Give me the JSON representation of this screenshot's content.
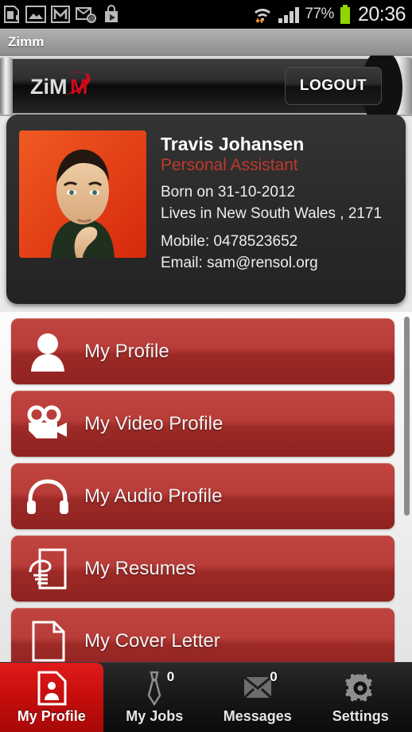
{
  "statusbar": {
    "icons": [
      "sdcard-icon",
      "gallery-icon",
      "gmail-icon",
      "email-icon",
      "play-store-icon"
    ],
    "wifi_icon": "wifi-icon",
    "signal_icon": "signal-bars-icon",
    "battery_percent": "77%",
    "battery_icon": "battery-icon",
    "clock": "20:36"
  },
  "titlebar": {
    "title": "Zimm"
  },
  "header": {
    "logo_text_light": "ZiM",
    "logo_text_red": "M",
    "logo_name": "zimm-logo",
    "logout_label": "LOGOUT"
  },
  "profile": {
    "avatar_name": "profile-photo",
    "name": "Travis Johansen",
    "role": "Personal Assistant",
    "born": "Born on 31-10-2012",
    "lives": "Lives in New South Wales , 2171",
    "mobile": "Mobile: 0478523652",
    "email": "Email: sam@rensol.org"
  },
  "menu": {
    "items": [
      {
        "label": "My Profile",
        "icon": "person-icon"
      },
      {
        "label": "My Video Profile",
        "icon": "video-camera-icon"
      },
      {
        "label": "My Audio Profile",
        "icon": "headphones-icon"
      },
      {
        "label": "My Resumes",
        "icon": "resume-hand-icon"
      },
      {
        "label": "My Cover Letter",
        "icon": "document-icon"
      }
    ]
  },
  "tabs": [
    {
      "label": "My Profile",
      "icon": "profile-card-icon",
      "active": true,
      "badge": ""
    },
    {
      "label": "My Jobs",
      "icon": "tie-icon",
      "active": false,
      "badge": "0"
    },
    {
      "label": "Messages",
      "icon": "envelope-icon",
      "active": false,
      "badge": "0"
    },
    {
      "label": "Settings",
      "icon": "gear-icon",
      "active": false,
      "badge": ""
    }
  ],
  "colors": {
    "accent_red": "#c0392b",
    "button_red": "#b83c38",
    "tab_active_red": "#c50d0d"
  }
}
